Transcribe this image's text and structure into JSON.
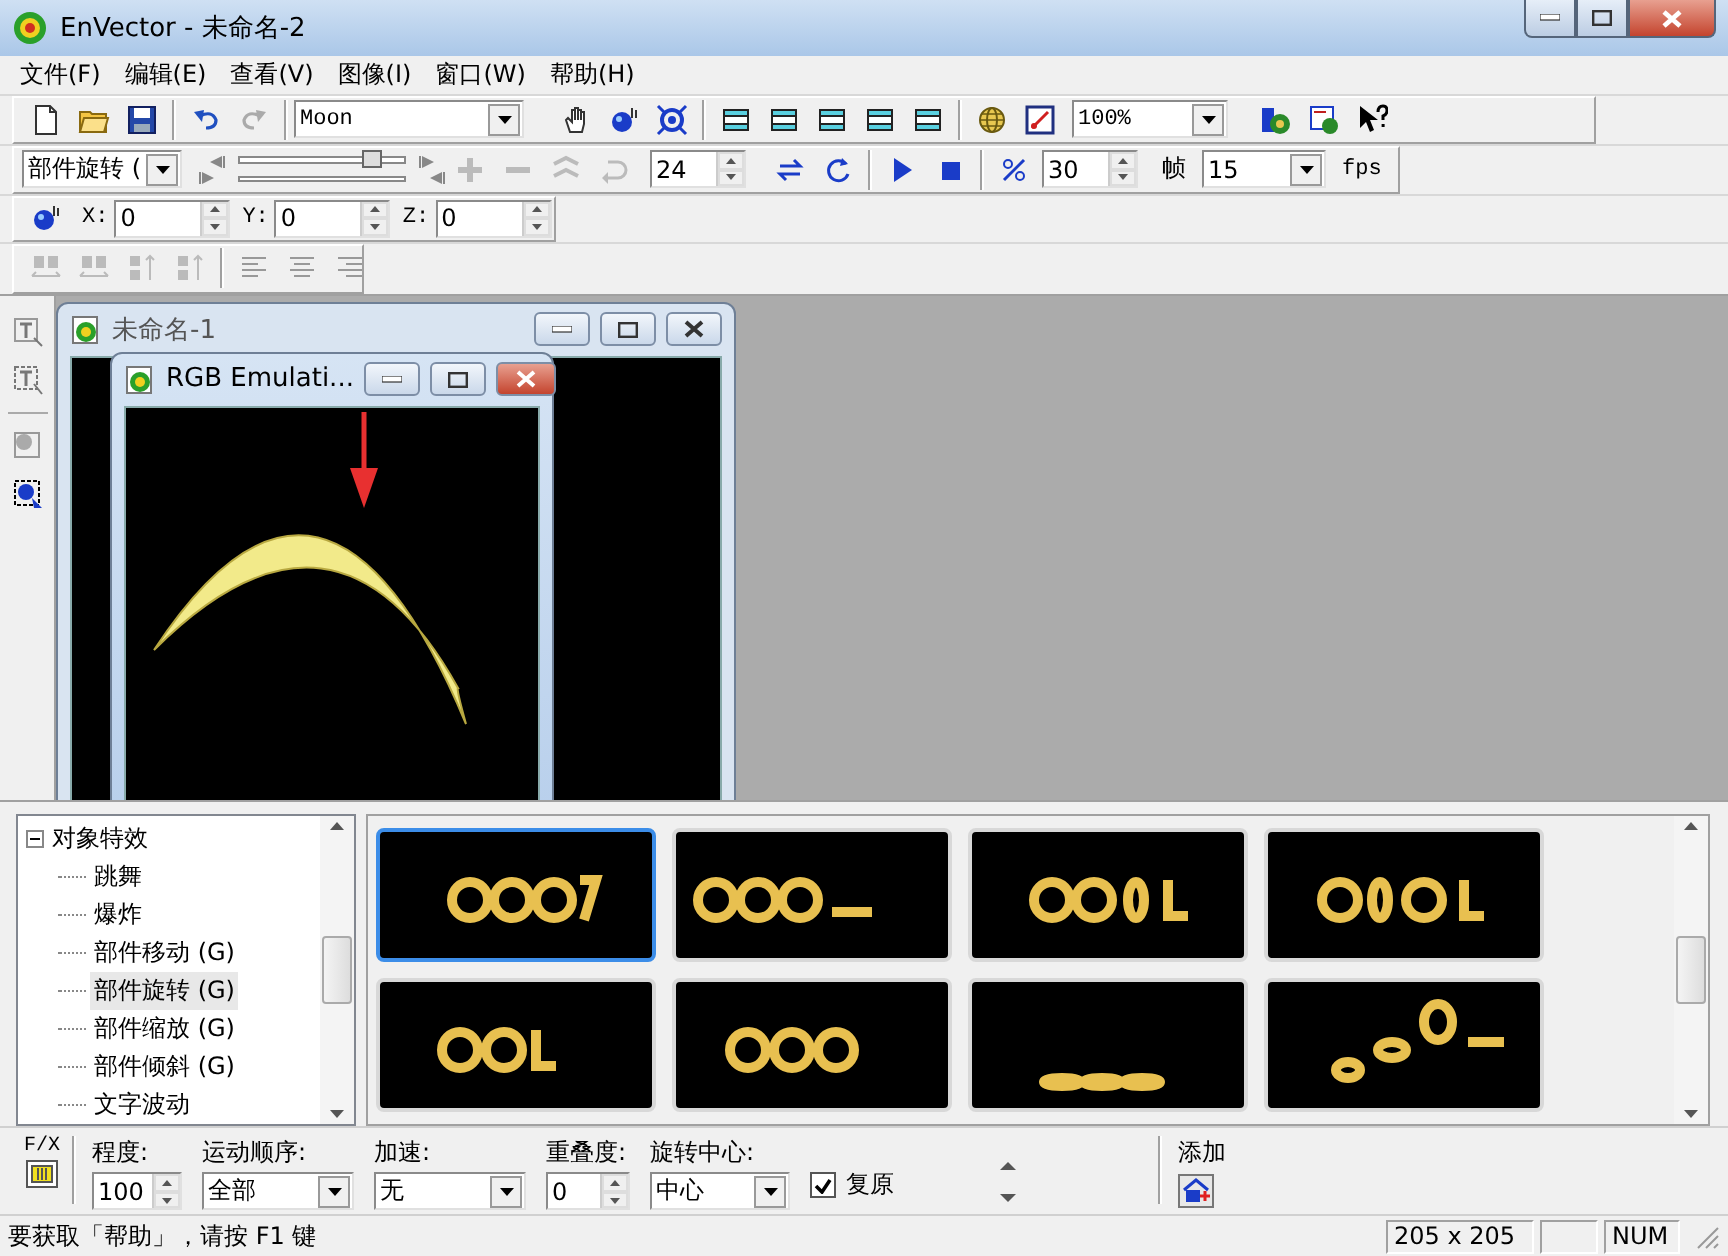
{
  "window": {
    "title": "EnVector - 未命名-2"
  },
  "menu": [
    "文件(F)",
    "编辑(E)",
    "查看(V)",
    "图像(I)",
    "窗口(W)",
    "帮助(H)"
  ],
  "toolbar": {
    "shape_select": "Moon",
    "zoom_select": "100%"
  },
  "animation_bar": {
    "effect_select": "部件旋转 (",
    "slider": {
      "level": 0.8
    },
    "steps": "24",
    "speed": "30",
    "speed_unit": "帧",
    "fps_select": "15",
    "fps_label": "fps"
  },
  "position_bar": [
    {
      "label": "X:",
      "value": "0"
    },
    {
      "label": "Y:",
      "value": "0"
    },
    {
      "label": "Z:",
      "value": "0"
    }
  ],
  "documents": [
    {
      "title": "未命名-1",
      "active": false
    },
    {
      "title": "RGB Emulati...",
      "active": true
    }
  ],
  "effects_tree": {
    "label": "对象特效",
    "expanded": true,
    "children": [
      {
        "label": "跳舞",
        "selected": false
      },
      {
        "label": "爆炸",
        "selected": false
      },
      {
        "label": "部件移动 (G)",
        "selected": false
      },
      {
        "label": "部件旋转 (G)",
        "selected": true
      },
      {
        "label": "部件缩放 (G)",
        "selected": false
      },
      {
        "label": "部件倾斜 (G)",
        "selected": false
      },
      {
        "label": "文字波动",
        "selected": false
      }
    ]
  },
  "previews": [
    {
      "selected": true
    },
    {
      "selected": false
    },
    {
      "selected": false
    },
    {
      "selected": false
    },
    {
      "selected": false
    },
    {
      "selected": false
    },
    {
      "selected": false
    },
    {
      "selected": false
    }
  ],
  "settings": {
    "fx_label": "F/X",
    "fields": [
      {
        "kind": "spin",
        "label": "程度:",
        "value": "100"
      },
      {
        "kind": "select",
        "label": "运动顺序:",
        "value": "全部"
      },
      {
        "kind": "select",
        "label": "加速:",
        "value": "无"
      },
      {
        "kind": "spin",
        "label": "重叠度:",
        "value": "0"
      },
      {
        "kind": "select",
        "label": "旋转中心:",
        "value": "中心"
      }
    ],
    "restore": {
      "label": "复原",
      "checked": true
    },
    "add_label": "添加"
  },
  "status_bar": {
    "message": "要获取「帮助」，请按 F1 键",
    "size": "205 x 205",
    "num": "NUM"
  }
}
